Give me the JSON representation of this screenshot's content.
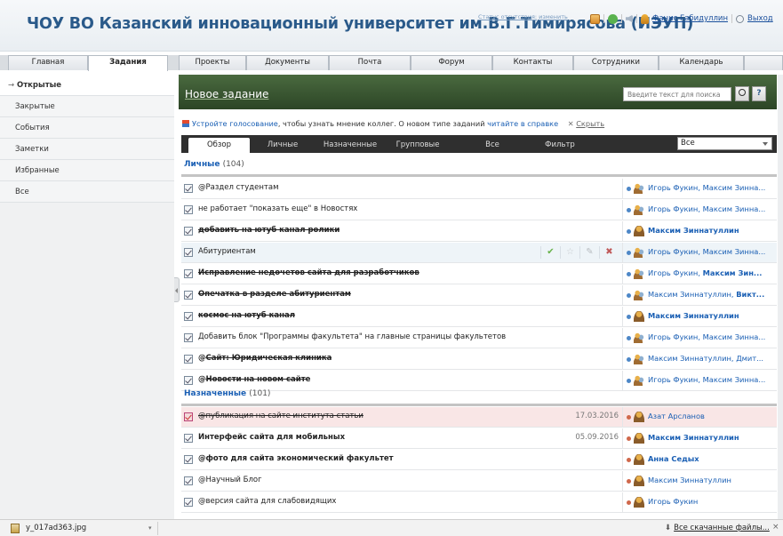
{
  "header": {
    "title": "ЧОУ ВО Казанский инновационный университет им.В.Г.Тимирясова (ИЭУП)",
    "status_label": "Статус отсутствия:",
    "status_link": "изменить",
    "user_name": "Фанис Габидуллин",
    "logout": "Выход"
  },
  "main_tabs": [
    {
      "label": "Главная"
    },
    {
      "label": "Задания"
    },
    {
      "label": "Проекты"
    },
    {
      "label": "Документы"
    },
    {
      "label": "Почта"
    },
    {
      "label": "Форум"
    },
    {
      "label": "Контакты"
    },
    {
      "label": "Сотрудники"
    },
    {
      "label": "Календарь"
    }
  ],
  "sidebar": {
    "items": [
      {
        "label": "Открытые"
      },
      {
        "label": "Закрытые"
      },
      {
        "label": "События"
      },
      {
        "label": "Заметки"
      },
      {
        "label": "Избранные"
      },
      {
        "label": "Все"
      }
    ]
  },
  "content": {
    "title": "Новое задание",
    "search_placeholder": "Введите текст для поиска",
    "help": "?",
    "info": {
      "link1": "Устройте голосование",
      "text1": ", чтобы узнать мнение коллег. О новом типе заданий ",
      "link2": "читайте в справке",
      "x": "✕",
      "hide": "Скрыть"
    },
    "filter_tabs": [
      {
        "label": "Обзор"
      },
      {
        "label": "Личные"
      },
      {
        "label": "Назначенные"
      },
      {
        "label": "Групповые"
      },
      {
        "label": "Все"
      },
      {
        "label": "Фильтр"
      }
    ],
    "filter_select": "Все",
    "sections": [
      {
        "label": "Личные",
        "count": "(104)"
      },
      {
        "label": "Назначенные",
        "count": "(101)"
      }
    ],
    "personal": [
      {
        "name": "@Раздел студентам",
        "people": "Игорь Фукин, Максим Зинна..."
      },
      {
        "name": "не работает \"показать еще\" в Новостях",
        "people": "Игорь Фукин, Максим Зинна..."
      },
      {
        "name": "добавить на ютуб канал ролики",
        "people": "Максим Зиннатуллин"
      },
      {
        "name": "Абитуриентам",
        "people": "Игорь Фукин, Максим Зинна..."
      },
      {
        "name": "Исправление недочетов сайта для разработчиков",
        "people_a": "Игорь Фукин, ",
        "people_b": "Максим Зин..."
      },
      {
        "name": "Опечатка в разделе абитуриентам",
        "people_a": "Максим Зиннатуллин, ",
        "people_b": "Викт..."
      },
      {
        "name": "космос на ютуб канал",
        "people": "Максим Зиннатуллин"
      },
      {
        "name": "Добавить блок \"Программы факультета\" на главные страницы факультетов",
        "people": "Игорь Фукин, Максим Зинна..."
      },
      {
        "name_prefix": "@",
        "name": "Сайт: Юридическая клиника",
        "people": "Максим Зиннатуллин, Дмит..."
      },
      {
        "name_prefix": "@",
        "name": "Новости на новом сайте",
        "people": "Игорь Фукин, Максим Зинна..."
      }
    ],
    "assigned": [
      {
        "name": "@публикация на сайте института статьи",
        "date": "17.03.2016",
        "people": "Азат Арсланов"
      },
      {
        "name": "Интерфейс сайта для мобильных",
        "date": "05.09.2016",
        "people": "Максим Зиннатуллин"
      },
      {
        "name": "@фото для сайта экономический факультет",
        "people": "Анна Седых"
      },
      {
        "name": "@Научный Блог",
        "people": "Максим Зиннатуллин"
      },
      {
        "name": "@версия сайта для слабовидящих",
        "people": "Игорь Фукин"
      }
    ]
  },
  "downloads": {
    "file": "y_017ad363.jpg",
    "all": "Все скачанные файлы..."
  },
  "icons": {
    "ok": "✔",
    "star": "☆",
    "edit": "✎",
    "del": "✖",
    "arrow": "→",
    "download": "⬇",
    "close": "×",
    "caret": "▾"
  }
}
